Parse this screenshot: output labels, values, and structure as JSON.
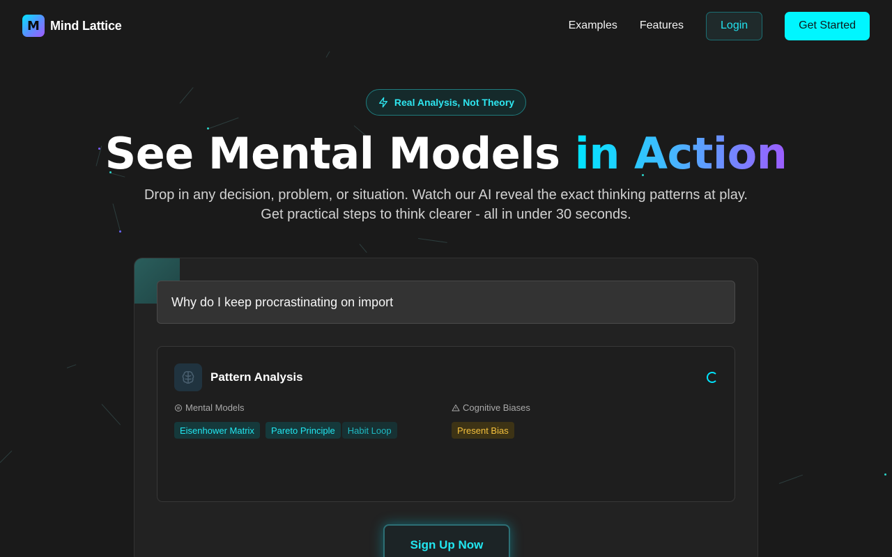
{
  "app": {
    "name": "Mind Lattice",
    "logo_letter": "M"
  },
  "nav": {
    "examples": "Examples",
    "features": "Features",
    "login": "Login",
    "get_started": "Get Started"
  },
  "hero": {
    "badge": "Real Analysis, Not Theory",
    "title_main": "See Mental Models ",
    "title_accent": "in Action",
    "subtitle": "Drop in any decision, problem, or situation. Watch our AI reveal the exact thinking patterns at play. Get practical steps to think clearer - all in under 30 seconds."
  },
  "demo": {
    "query_value": "Why do I keep procrastinating on import",
    "panel": {
      "title": "Pattern Analysis",
      "mental_models_label": "Mental Models",
      "mental_models": [
        "Eisenhower Matrix",
        "Pareto Principle",
        "Habit Loop"
      ],
      "biases_label": "Cognitive Biases",
      "biases": [
        "Present Bias"
      ]
    },
    "cta": "Sign Up Now"
  },
  "colors": {
    "accent": "#00f6ff",
    "background": "#1a1a1a",
    "bias": "#f5c13d"
  }
}
